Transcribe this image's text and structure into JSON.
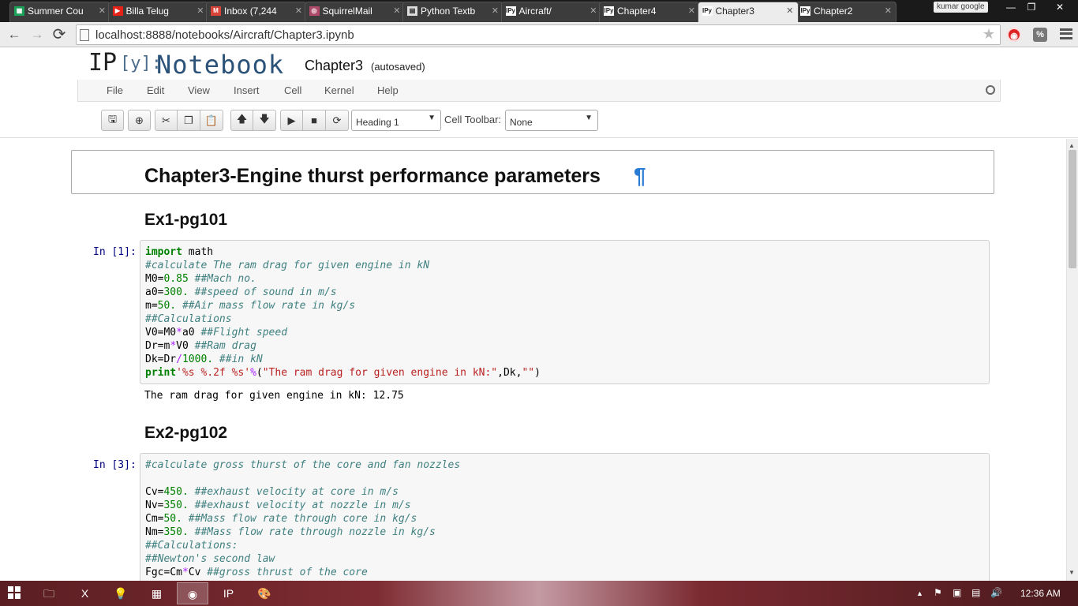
{
  "browser": {
    "tabs": [
      {
        "title": "Summer Cou",
        "icon": "sheet-icon",
        "color": "#1da15a"
      },
      {
        "title": "Billa Telug",
        "icon": "youtube-icon",
        "color": "#e62117"
      },
      {
        "title": "Inbox (7,244",
        "icon": "gmail-icon",
        "color": "#d9443a"
      },
      {
        "title": "SquirrelMail",
        "icon": "squirrelmail-icon",
        "color": "#b04a6a"
      },
      {
        "title": "Python Textb",
        "icon": "document-icon",
        "color": "#dddddd"
      },
      {
        "title": "Aircraft/",
        "icon": "ipython-icon",
        "color": "#ffffff"
      },
      {
        "title": "Chapter4",
        "icon": "ipython-icon",
        "color": "#ffffff"
      },
      {
        "title": "Chapter3",
        "icon": "ipython-icon",
        "color": "#ffffff"
      },
      {
        "title": "Chapter2",
        "icon": "ipython-icon",
        "color": "#ffffff"
      }
    ],
    "tab_icon_text": {
      "ipython": "IPy",
      "youtube": "▶",
      "sheet": "▦",
      "gmail": "M",
      "squirrelmail": "◎",
      "document": "▤"
    },
    "active_tab_index": 7,
    "profile": "kumar google",
    "window_controls": {
      "minimize": "—",
      "maximize": "❐",
      "close": "✕"
    },
    "url": "localhost:8888/notebooks/Aircraft/Chapter3.ipynb",
    "nav_icons": {
      "back": "←",
      "forward": "→",
      "reload": "⟳",
      "star": "★"
    }
  },
  "notebook": {
    "logo_ip": "IP",
    "logo_brackets": "[y]:",
    "logo_notebook": "Notebook",
    "name": "Chapter3",
    "save_status": "(autosaved)",
    "menu": [
      "File",
      "Edit",
      "View",
      "Insert",
      "Cell",
      "Kernel",
      "Help"
    ],
    "cell_type_select": "Heading 1",
    "cell_toolbar_label": "Cell Toolbar:",
    "cell_toolbar_select": "None"
  },
  "toolbar_icons": {
    "save": "🖫",
    "insert": "⊕",
    "cut": "✂",
    "copy": "❐",
    "paste": "📋",
    "move_up": "🡅",
    "move_down": "🡇",
    "run": "▶",
    "stop": "■",
    "restart": "⟳"
  },
  "cells": {
    "h1_text": "Chapter3-Engine thurst performance parameters",
    "h1_anchor": "¶",
    "ex1_title": "Ex1-pg101",
    "ex1_prompt": "In [1]:",
    "ex1_output": "The ram drag for given engine in kN: 12.75",
    "ex2_title": "Ex2-pg102",
    "ex2_prompt": "In [3]:"
  },
  "code1": [
    {
      "k": "import",
      "t": " math"
    },
    {
      "c": "#calculate The ram drag for given engine in kN"
    },
    {
      "t": "M0=",
      "n": "0.85",
      "c2": " ##Mach no."
    },
    {
      "t": "a0=",
      "n": "300.",
      "c2": " ##speed of sound in m/s"
    },
    {
      "t": "m=",
      "n": "50.",
      "c2": " ##Air mass flow rate in kg/s"
    },
    {
      "c": "##Calculations"
    },
    {
      "t": "V0=M0",
      "o": "*",
      "t2": "a0",
      "c2": " ##Flight speed"
    },
    {
      "t": "Dr=m",
      "o": "*",
      "t2": "V0",
      "c2": " ##Ram drag"
    },
    {
      "t": "Dk=Dr",
      "o": "/",
      "n2": "1000.",
      "c2": " ##in kN"
    },
    {
      "k": "print",
      "s": "'%s %.2f %s'",
      "o": "%",
      "t2": "(",
      "s2": "\"The ram drag for given engine in kN:\"",
      "t3": ",Dk,",
      "s3": "\"\"",
      "t4": ")"
    }
  ],
  "code2": [
    {
      "c": "#calculate gross thurst of the core and fan nozzles"
    },
    {
      "t": ""
    },
    {
      "t": "Cv=",
      "n": "450.",
      "c2": " ##exhaust velocity at core in m/s"
    },
    {
      "t": "Nv=",
      "n": "350.",
      "c2": " ##exhaust velocity at nozzle in m/s"
    },
    {
      "t": "Cm=",
      "n": "50.",
      "c2": " ##Mass flow rate through core in kg/s"
    },
    {
      "t": "Nm=",
      "n": "350.",
      "c2": " ##Mass flow rate through nozzle in kg/s"
    },
    {
      "c": "##Calculations:"
    },
    {
      "c": "##Newton's second law"
    },
    {
      "t": "Fgc=Cm",
      "o": "*",
      "t2": "Cv",
      "c2": " ##gross thrust of the core"
    }
  ],
  "taskbar": {
    "apps": [
      {
        "name": "file-explorer-icon",
        "glyph": "🗀"
      },
      {
        "name": "excel-icon",
        "glyph": "X"
      },
      {
        "name": "lightbulb-icon",
        "glyph": "💡"
      },
      {
        "name": "calculator-icon",
        "glyph": "▦"
      },
      {
        "name": "chrome-icon",
        "glyph": "◉"
      },
      {
        "name": "ipython-icon",
        "glyph": "IP"
      },
      {
        "name": "paint-icon",
        "glyph": "🎨"
      }
    ],
    "tray": {
      "arrow": "▲",
      "flag": "⚑",
      "network": "▣",
      "display": "▤",
      "volume": "🔊"
    },
    "clock": "12:36 AM"
  }
}
